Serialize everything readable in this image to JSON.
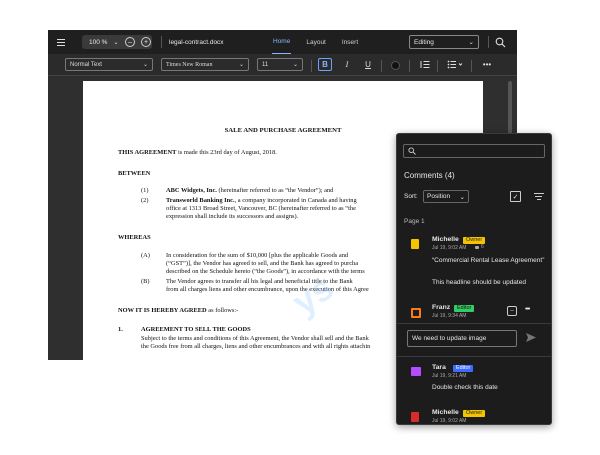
{
  "toolbar": {
    "zoom": "100 %",
    "filename": "legal-contract.docx",
    "tabs": [
      "Home",
      "Layout",
      "Insert"
    ],
    "mode": "Editing"
  },
  "format": {
    "style": "Normal Text",
    "font": "Times New Roman",
    "size": "11",
    "bold": "B",
    "italic": "I",
    "underline": "U"
  },
  "document": {
    "title": "SALE AND PURCHASE AGREEMENT",
    "intro_bold": "THIS AGREEMENT",
    "intro_rest": " is made this 23rd day of August, 2018.",
    "between": "BETWEEN",
    "party1_num": "(1)",
    "party1_bold": "ABC Widgets, Inc.",
    "party1_rest": " (hereinafter referred to as “the Vendor”); and",
    "party2_num": "(2)",
    "party2_bold": "Transworld Banking Inc.",
    "party2_rest": ", a company incorporated in Canada and having",
    "party2_line2": "office at 1313 Broad Street, Vancouver, BC (hereinafter referred to as “the",
    "party2_line3": "expression shall include its successors and assigns).",
    "whereas": "WHEREAS",
    "wa_num": "(A)",
    "wa_line1": "In consideration for the sum of $10,000 [plus the applicable Goods and",
    "wa_line2": "(“GST”)], the Vendor has agreed to sell, and the Bank has agreed to purcha",
    "wa_line3": "described on the Schedule hereto (“the Goods”), in accordance with the terms",
    "wb_num": "(B)",
    "wb_line1": "The Vendor agrees to transfer all his legal and beneficial title to the Bank",
    "wb_line2": "from all charges liens and other encumbrance, upon the execution of this Agree",
    "agreed_bold": "NOW IT IS HEREBY AGREED",
    "agreed_rest": " as follows:-",
    "s1_num": "1.",
    "s1_title": "AGREEMENT TO SELL THE GOODS",
    "s1_line1": "Subject to the terms and conditions of this Agreement, the Vendor shall sell and the Bank",
    "s1_line2": "the Goods free from all charges, liens and other encumbrances and with all rights attachin",
    "watermark": "ys"
  },
  "comments": {
    "title": "Comments (4)",
    "sort_label": "Sort:",
    "sort_value": "Position",
    "page_label": "Page 1",
    "reply_value": "We need to update image",
    "items": [
      {
        "name": "Michelle",
        "role": "Owner",
        "time": "Jul 19, 9:02 AM",
        "count": "6",
        "quote": "“Commercial Rental Lease Agreement”",
        "text": "This headline should be updated",
        "avatar_color": "#f5c400",
        "role_color": "#f5c400"
      },
      {
        "name": "Franz",
        "role": "Editor",
        "time": "Jul 19, 9:34 AM",
        "avatar_color": "#ff7a1a",
        "role_color": "#33cc66"
      },
      {
        "name": "Tara",
        "role": "Editor",
        "time": "Jul 19, 9:21 AM",
        "text": "Double check this date",
        "avatar_color": "#b34dff",
        "role_color": "#3b6bff"
      },
      {
        "name": "Michelle",
        "role": "Owner",
        "time": "Jul 19, 9:02 AM",
        "avatar_color": "#d92b2b",
        "role_color": "#f5c400"
      }
    ]
  }
}
